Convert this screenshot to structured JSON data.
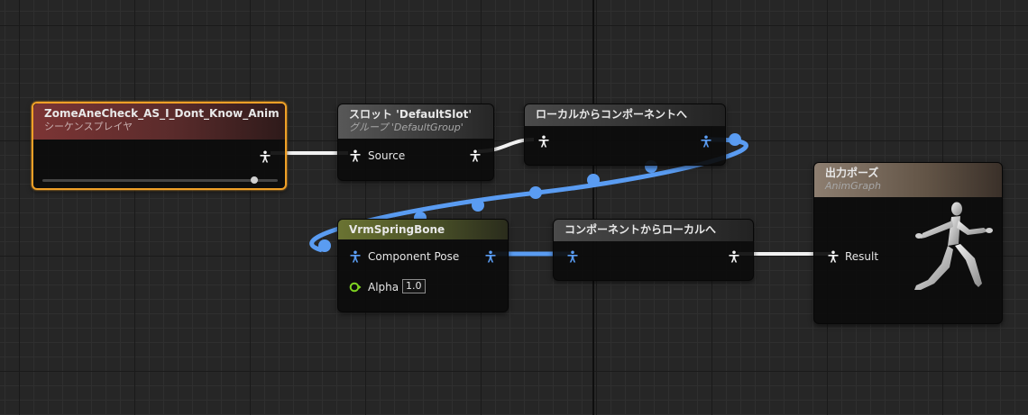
{
  "colors": {
    "exec_wire": "#f2f2f2",
    "pose_wire": "#5a9cf2",
    "selection": "#f0a027",
    "float_pin": "#7ed321"
  },
  "nodes": {
    "sequence_player": {
      "title": "ZomeAneCheck_AS_I_Dont_Know_Anim",
      "subtitle": "シーケンスプレイヤ",
      "play_rate": 0.9
    },
    "slot": {
      "title": "スロット 'DefaultSlot'",
      "subtitle": "グループ 'DefaultGroup'",
      "pin_source": "Source"
    },
    "local_to_component": {
      "title": "ローカルからコンポーネントへ"
    },
    "spring_bone": {
      "title": "VrmSpringBone",
      "pin_component_pose": "Component Pose",
      "pin_alpha": "Alpha",
      "alpha_value": "1.0"
    },
    "component_to_local": {
      "title": "コンポーネントからローカルへ"
    },
    "output_pose": {
      "title": "出力ポーズ",
      "subtitle": "AnimGraph",
      "pin_result": "Result",
      "icon": "running-mannequin-icon"
    }
  }
}
